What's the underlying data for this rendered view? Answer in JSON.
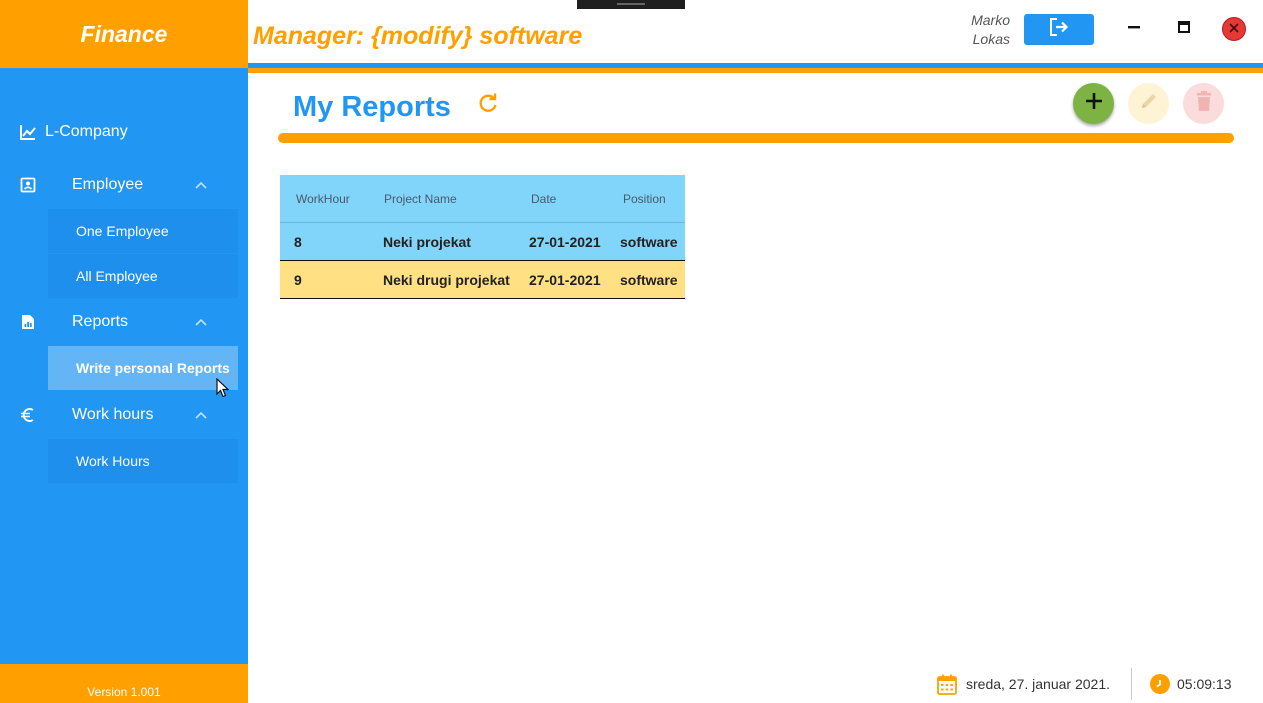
{
  "app": {
    "brand": "Finance",
    "title": "Manager: {modify} software",
    "version": "Version 1.001"
  },
  "user": {
    "first_name": "Marko",
    "last_name": "Lokas"
  },
  "sidebar": {
    "company": "L-Company",
    "groups": [
      {
        "label": "Employee",
        "icon": "contact-card-icon",
        "items": [
          "One Employee",
          "All Employee"
        ]
      },
      {
        "label": "Reports",
        "icon": "report-file-icon",
        "items": [
          "Write personal Reports"
        ]
      },
      {
        "label": "Work hours",
        "icon": "euro-icon",
        "items": [
          "Work Hours"
        ]
      }
    ],
    "active_item": "Write personal Reports"
  },
  "page": {
    "title": "My Reports"
  },
  "table": {
    "headers": [
      "WorkHour",
      "Project Name",
      "Date",
      "Position"
    ],
    "rows": [
      [
        "8",
        "Neki projekat",
        "27-01-2021",
        "software"
      ],
      [
        "9",
        "Neki drugi projekat",
        "27-01-2021",
        "software"
      ]
    ]
  },
  "status": {
    "date": "sreda, 27. januar 2021.",
    "time": "05:09:13"
  },
  "colors": {
    "primary": "#2196f3",
    "accent": "#ffa000",
    "row_blue": "#81d4fa",
    "row_yellow": "#ffe082",
    "add": "#7cb342",
    "close": "#e53935"
  }
}
